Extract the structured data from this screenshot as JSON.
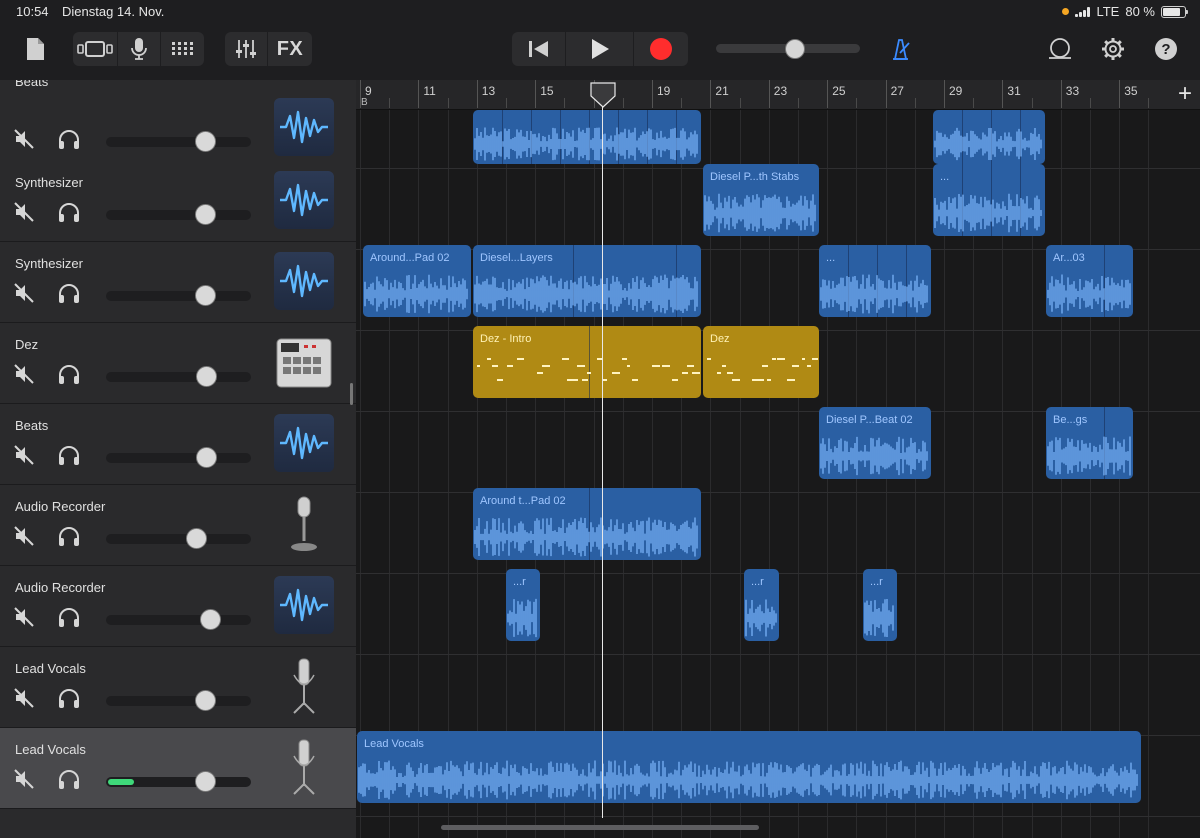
{
  "status": {
    "time": "10:54",
    "date": "Dienstag 14. Nov.",
    "network": "LTE",
    "battery_text": "80 %",
    "battery_level": 0.8
  },
  "toolbar": {
    "fx_label": "FX",
    "master_volume": 0.55,
    "icons": [
      "document-icon",
      "track-view-icon",
      "microphone-icon",
      "grid-icon",
      "mixer-icon",
      "rewind-icon",
      "play-icon",
      "record-icon",
      "metronome-icon",
      "loop-icon",
      "settings-icon",
      "help-icon"
    ],
    "colors": {
      "record": "#ff2d2d",
      "metronome": "#3b8bff"
    }
  },
  "ruler": {
    "labels": [
      "9",
      "11",
      "13",
      "15",
      "17",
      "19",
      "21",
      "23",
      "25",
      "27",
      "29",
      "31",
      "33",
      "35"
    ],
    "start_marker": "B",
    "playhead_bar": "17"
  },
  "tracks": [
    {
      "name": "Beats",
      "volume": 0.68,
      "instrument": "waveform-icon",
      "selected": false,
      "partial": true
    },
    {
      "name": "Synthesizer",
      "volume": 0.68,
      "instrument": "waveform-icon",
      "selected": false
    },
    {
      "name": "Synthesizer",
      "volume": 0.68,
      "instrument": "waveform-icon",
      "selected": false
    },
    {
      "name": "Dez",
      "volume": 0.69,
      "instrument": "drum-machine-icon",
      "selected": false
    },
    {
      "name": "Beats",
      "volume": 0.69,
      "instrument": "waveform-icon",
      "selected": false
    },
    {
      "name": "Audio Recorder",
      "volume": 0.62,
      "instrument": "microphone-icon",
      "selected": false
    },
    {
      "name": "Audio Recorder",
      "volume": 0.72,
      "instrument": "waveform-icon",
      "selected": false
    },
    {
      "name": "Lead Vocals",
      "volume": 0.68,
      "instrument": "studio-mic-icon",
      "selected": false
    },
    {
      "name": "Lead Vocals",
      "volume": 0.68,
      "instrument": "studio-mic-icon",
      "selected": true,
      "meter_level": 0.18
    }
  ],
  "regions": [
    {
      "lane": 0,
      "label": "",
      "color": "blue"
    },
    {
      "lane": 0,
      "label": "",
      "color": "blue"
    },
    {
      "lane": 1,
      "label": "Diesel P...th Stabs",
      "color": "blue"
    },
    {
      "lane": 1,
      "label": "...",
      "color": "blue"
    },
    {
      "lane": 2,
      "label": "Around...Pad 02",
      "color": "blue"
    },
    {
      "lane": 2,
      "label": "Diesel...Layers",
      "color": "blue"
    },
    {
      "lane": 2,
      "label": "...",
      "color": "blue"
    },
    {
      "lane": 2,
      "label": "Ar...03",
      "color": "blue"
    },
    {
      "lane": 3,
      "label": "Dez - Intro",
      "color": "yellow"
    },
    {
      "lane": 3,
      "label": "Dez",
      "color": "yellow"
    },
    {
      "lane": 4,
      "label": "Diesel P...Beat 02",
      "color": "blue"
    },
    {
      "lane": 4,
      "label": "Be...gs",
      "color": "blue"
    },
    {
      "lane": 5,
      "label": "Around t...Pad 02",
      "color": "blue"
    },
    {
      "lane": 6,
      "label": "...r",
      "color": "blue"
    },
    {
      "lane": 6,
      "label": "...r",
      "color": "blue"
    },
    {
      "lane": 6,
      "label": "...r",
      "color": "blue"
    },
    {
      "lane": 8,
      "label": "Lead Vocals",
      "color": "blue"
    }
  ]
}
